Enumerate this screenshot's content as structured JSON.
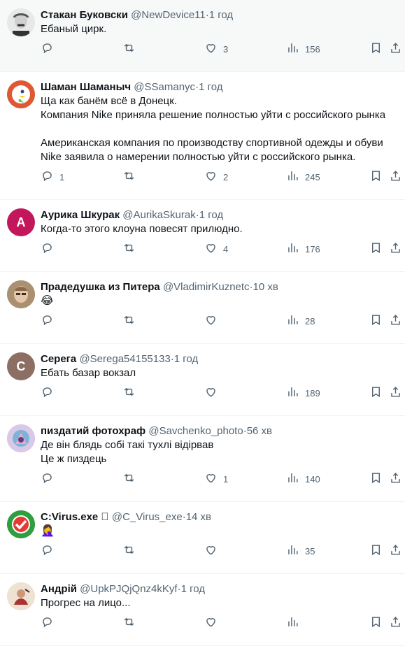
{
  "tweets": [
    {
      "name": "Стакан Буковски",
      "handle": "@NewDevice11",
      "time": "1 год",
      "lines": [
        "Ебаный цирк."
      ],
      "replies": "",
      "retweets": "",
      "likes": "3",
      "views": "156",
      "avatar": {
        "type": "photo",
        "bg": "#e0e0e0"
      },
      "highlight": true
    },
    {
      "name": "Шаман Шаманыч",
      "handle": "@SSamanyc",
      "time": "1 год",
      "lines": [
        "Ща как банём всё в Донецк.",
        "Компания Nike приняла решение полностью уйти с российского рынка",
        "",
        "Американская компания по производству спортивной одежды и обуви Nike заявила о намерении полностью уйти с российского рынка."
      ],
      "replies": "1",
      "retweets": "",
      "likes": "2",
      "views": "245",
      "avatar": {
        "type": "duck",
        "bg": "#de5833"
      },
      "highlight": false
    },
    {
      "name": "Аурика Шкурак",
      "handle": "@AurikaSkurak",
      "time": "1 год",
      "lines": [
        "Когда-то этого клоуна повесят прилюдно."
      ],
      "replies": "",
      "retweets": "",
      "likes": "4",
      "views": "176",
      "avatar": {
        "type": "letter",
        "letter": "A",
        "bg": "#c2185b"
      },
      "highlight": false
    },
    {
      "name": "Прадедушка из Питера",
      "handle": "@VladimirKuznetc",
      "time": "10 хв",
      "lines": [
        "😂"
      ],
      "replies": "",
      "retweets": "",
      "likes": "",
      "views": "28",
      "avatar": {
        "type": "photo2",
        "bg": "#b89a6a"
      },
      "highlight": false
    },
    {
      "name": "Серега",
      "handle": "@Serega54155133",
      "time": "1 год",
      "lines": [
        "Ебать базар вокзал"
      ],
      "replies": "",
      "retweets": "",
      "likes": "",
      "views": "189",
      "avatar": {
        "type": "letter",
        "letter": "С",
        "bg": "#8d6e63"
      },
      "highlight": false
    },
    {
      "name": "пиздатий фотохраф",
      "handle": "@Savchenko_photo",
      "time": "56 хв",
      "lines": [
        "Де він блядь собі такі тухлі відірвав",
        "Це ж пиздець"
      ],
      "replies": "",
      "retweets": "",
      "likes": "1",
      "views": "140",
      "avatar": {
        "type": "art",
        "bg": "#c7b3d6"
      },
      "highlight": false
    },
    {
      "name": "C:Virus.exe ⃣",
      "handle": "@C_Virus_exe",
      "time": "14 хв",
      "lines": [
        "🤦‍♀️"
      ],
      "replies": "",
      "retweets": "",
      "likes": "",
      "views": "35",
      "avatar": {
        "type": "check",
        "bg": "#2e7d32"
      },
      "highlight": false
    },
    {
      "name": "Андрій",
      "handle": "@UpkPJQjQnz4kKyf",
      "time": "1 год",
      "lines": [
        "Прогрес на лицо..."
      ],
      "replies": "",
      "retweets": "",
      "likes": "",
      "views": "",
      "avatar": {
        "type": "art2",
        "bg": "#e8d9c8"
      },
      "highlight": false
    }
  ],
  "dot": "·"
}
